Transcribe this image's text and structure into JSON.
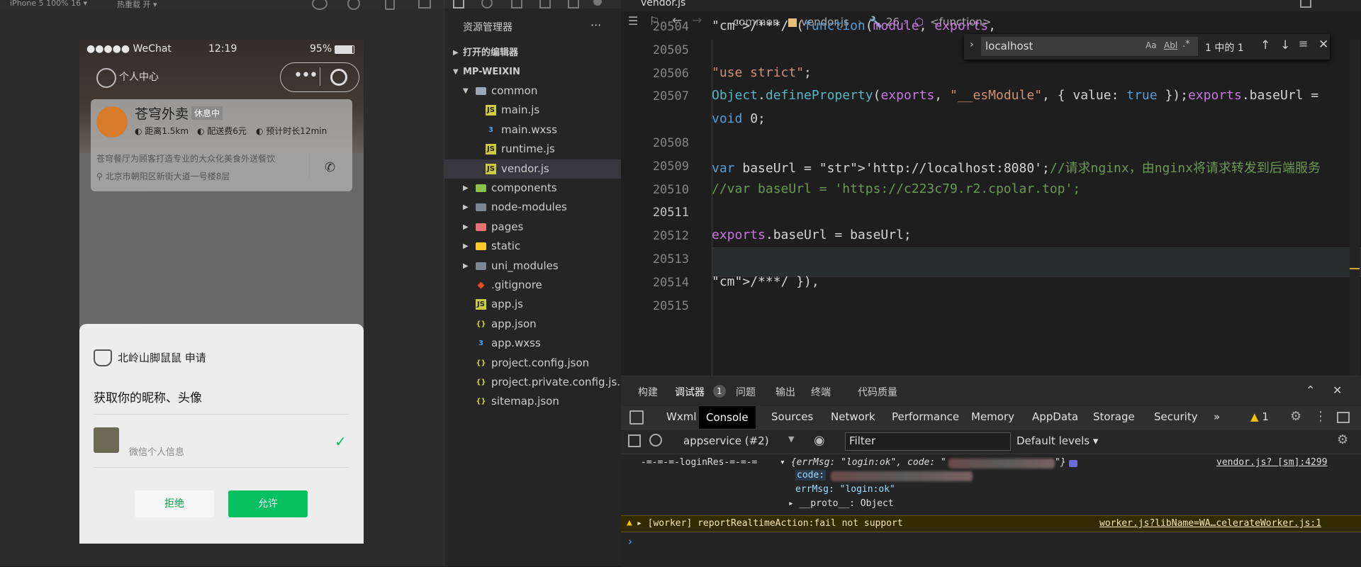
{
  "simulator": {
    "device_label": "iPhone 5 100% 16 ▾",
    "hot_reload": "热重载 开 ▾",
    "status_carrier": "●●●●● WeChat",
    "status_time": "12:19",
    "status_battery": "95%",
    "user_center": "个人中心",
    "shop": {
      "name": "苍穹外卖",
      "badge": "休息中",
      "distance": "距离1.5km",
      "delivery_fee": "配送费6元",
      "eta": "预计时长12min",
      "description": "苍穹餐厅为顾客打造专业的大众化美食外送餐饮",
      "address": "北京市朝阳区新街大道一号楼8层"
    },
    "modal": {
      "app_request": "北岭山脚鼠鼠 申请",
      "title": "获取你的昵称、头像",
      "profile_name": "",
      "profile_sub": "微信个人信息",
      "reject": "拒绝",
      "allow": "允许"
    }
  },
  "explorer": {
    "title": "资源管理器",
    "more": "···",
    "open_editors": "打开的编辑器",
    "project": "MP-WEIXIN",
    "items": [
      {
        "label": "common",
        "type": "folder-open",
        "depth": 1
      },
      {
        "label": "main.js",
        "type": "js",
        "depth": 2
      },
      {
        "label": "main.wxss",
        "type": "css",
        "depth": 2
      },
      {
        "label": "runtime.js",
        "type": "js",
        "depth": 2
      },
      {
        "label": "vendor.js",
        "type": "js",
        "depth": 2,
        "selected": true
      },
      {
        "label": "components",
        "type": "folder-green",
        "depth": 1
      },
      {
        "label": "node-modules",
        "type": "folder",
        "depth": 1
      },
      {
        "label": "pages",
        "type": "folder-red",
        "depth": 1
      },
      {
        "label": "static",
        "type": "folder-yellow",
        "depth": 1
      },
      {
        "label": "uni_modules",
        "type": "folder",
        "depth": 1
      },
      {
        "label": ".gitignore",
        "type": "git",
        "depth": 1
      },
      {
        "label": "app.js",
        "type": "js",
        "depth": 1
      },
      {
        "label": "app.json",
        "type": "json",
        "depth": 1
      },
      {
        "label": "app.wxss",
        "type": "css",
        "depth": 1
      },
      {
        "label": "project.config.json",
        "type": "json",
        "depth": 1
      },
      {
        "label": "project.private.config.js...",
        "type": "json",
        "depth": 1
      },
      {
        "label": "sitemap.json",
        "type": "json",
        "depth": 1
      }
    ]
  },
  "editor": {
    "tab": "vendor.js",
    "breadcrumb": [
      "common",
      "vendor.js",
      "26",
      "<function>"
    ],
    "find": {
      "query": "localhost",
      "result": "1 中的 1",
      "opt_case": "Aa",
      "opt_word": "Abl",
      "opt_regex": ".*"
    },
    "lines": [
      {
        "n": "20504",
        "text": "/***/ (function(module, exports,"
      },
      {
        "n": "20505",
        "text": ""
      },
      {
        "n": "20506",
        "text": "\"use strict\";"
      },
      {
        "n": "20507",
        "text": "Object.defineProperty(exports, \"__esModule\", { value: true });exports.baseUrl ="
      },
      {
        "n": "",
        "text": "void 0;"
      },
      {
        "n": "20508",
        "text": ""
      },
      {
        "n": "20509",
        "text": "var baseUrl = 'http://localhost:8080';//请求nginx，由nginx将请求转发到后端服务"
      },
      {
        "n": "20510",
        "text": "//var baseUrl = 'https://c223c79.r2.cpolar.top';"
      },
      {
        "n": "20511",
        "text": ""
      },
      {
        "n": "20512",
        "text": "exports.baseUrl = baseUrl;"
      },
      {
        "n": "20513",
        "text": ""
      },
      {
        "n": "20514",
        "text": "/***/ }),"
      },
      {
        "n": "20515",
        "text": ""
      }
    ]
  },
  "devtools": {
    "tabs": [
      "构建",
      "调试器",
      "问题",
      "输出",
      "终端",
      "代码质量"
    ],
    "debugger_badge": "1",
    "subtabs": [
      "Wxml",
      "Console",
      "Sources",
      "Network",
      "Performance",
      "Memory",
      "AppData",
      "Storage",
      "Security",
      "»"
    ],
    "warn_count": "1",
    "context": "appservice (#2)",
    "filter_placeholder": "Filter",
    "levels": "Default levels ▾",
    "log1": {
      "prefix": "-=-=-=-loginRes-=-=-=",
      "obj_open": "▾ {errMsg: \"login:ok\", code: \"",
      "obj_close": "\"}",
      "source": "vendor.js? [sm]:4299",
      "code_key": "code:",
      "errmsg_line": "errMsg: \"login:ok\"",
      "proto_line": "▸ __proto__: Object"
    },
    "warn": {
      "text": "▸ [worker] reportRealtimeAction:fail not support",
      "source": "worker.js?libName=WA…celerateWorker.js:1"
    },
    "prompt": "›"
  }
}
